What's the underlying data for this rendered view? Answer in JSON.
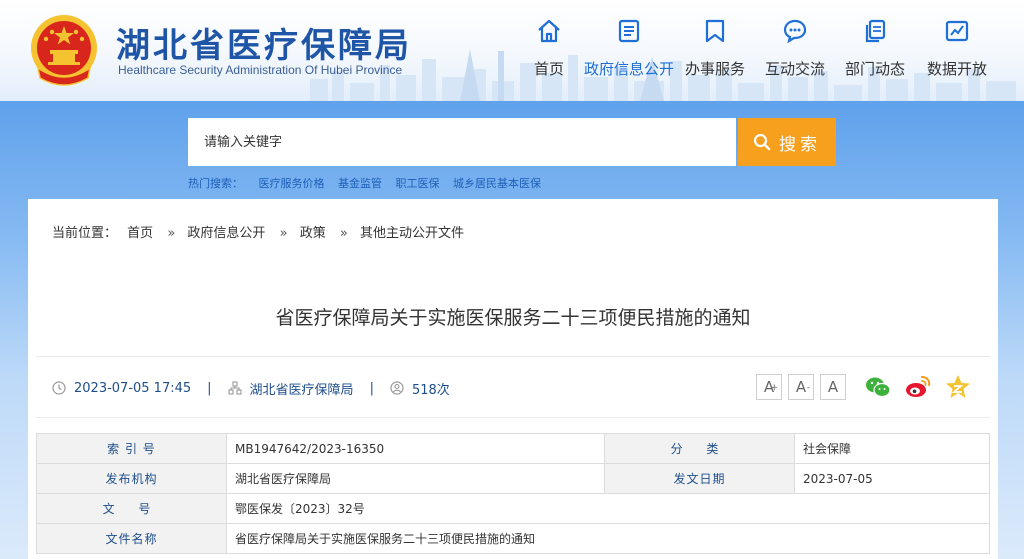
{
  "header": {
    "title": "湖北省医疗保障局",
    "subtitle": "Healthcare Security Administration Of Hubei Province",
    "nav": [
      {
        "label": "首页",
        "icon": "home-icon",
        "active": false
      },
      {
        "label": "政府信息公开",
        "icon": "document-list-icon",
        "active": true
      },
      {
        "label": "办事服务",
        "icon": "bookmark-icon",
        "active": false
      },
      {
        "label": "互动交流",
        "icon": "chat-bubble-icon",
        "active": false
      },
      {
        "label": "部门动态",
        "icon": "copy-document-icon",
        "active": false
      },
      {
        "label": "数据开放",
        "icon": "chart-edit-icon",
        "active": false
      }
    ]
  },
  "search": {
    "placeholder": "请输入关键字",
    "button_label": "搜索",
    "hot_label": "热门搜索：",
    "hot_terms": [
      "医疗服务价格",
      "基金监管",
      "职工医保",
      "城乡居民基本医保"
    ]
  },
  "breadcrumb": {
    "label": "当前位置：",
    "items": [
      "首页",
      "政府信息公开",
      "政策",
      "其他主动公开文件"
    ],
    "separator": "»"
  },
  "article": {
    "title": "省医疗保障局关于实施医保服务二十三项便民措施的通知",
    "datetime": "2023-07-05 17:45",
    "source": "湖北省医疗保障局",
    "views": "518次",
    "divider": "|"
  },
  "font_controls": {
    "increase": "A",
    "increase_sup": "+",
    "reset": "A",
    "reset_sup": "-",
    "default": "A"
  },
  "info_table": {
    "index_label": "索 引 号",
    "index_value": "MB1947642/2023-16350",
    "category_label": "分 类",
    "category_value": "社会保障",
    "issuer_label": "发布机构",
    "issuer_value": "湖北省医疗保障局",
    "date_label": "发文日期",
    "date_value": "2023-07-05",
    "docno_label": "文 号",
    "docno_value": "鄂医保发〔2023〕32号",
    "docname_label": "文件名称",
    "docname_value": "省医疗保障局关于实施医保服务二十三项便民措施的通知"
  },
  "colors": {
    "brand_blue": "#1f55a6",
    "active_nav": "#1f6fd6",
    "search_orange": "#f7a01d",
    "emblem_red": "#d9261c",
    "emblem_gold": "#f5c230"
  }
}
